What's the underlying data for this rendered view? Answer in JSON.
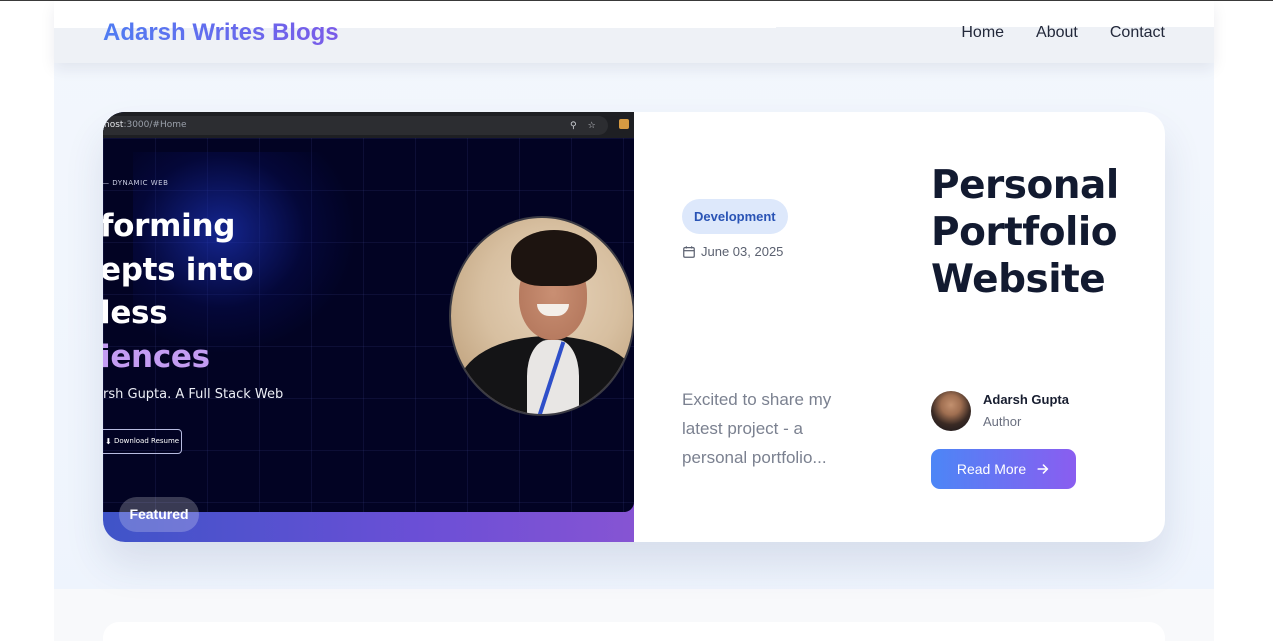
{
  "nav": {
    "brand": "Adarsh Writes Blogs",
    "links": [
      "Home",
      "About",
      "Contact"
    ]
  },
  "post": {
    "category": "Development",
    "date": "June 03, 2025",
    "title": "Personal Portfolio Website",
    "excerpt": "Excited to share my latest project - a personal portfolio...",
    "author_name": "Adarsh Gupta",
    "author_role": "Author",
    "read_more_label": "Read More",
    "badge": "Featured"
  },
  "thumbnail": {
    "url_prefix": "host",
    "url_rest": ":3000/#Home",
    "eyebrow": "— DYNAMIC WEB",
    "hero_lines": [
      "forming",
      "epts into",
      "less",
      "iences"
    ],
    "subtitle": "rsh Gupta. A Full Stack Web",
    "resume_label": "Download Resume"
  },
  "colors": {
    "brand_gradient_start": "#4f7cf2",
    "brand_gradient_end": "#7a5be8",
    "category_bg": "#dde8fb",
    "category_text": "#2953b5",
    "button_gradient_start": "#4c86f6",
    "button_gradient_end": "#8a5df0",
    "title_text": "#121a30"
  },
  "icons": {
    "date": "calendar-icon",
    "read_more": "arrow-right-icon",
    "browser_search": "search-icon",
    "browser_star": "star-icon",
    "resume": "download-icon"
  }
}
